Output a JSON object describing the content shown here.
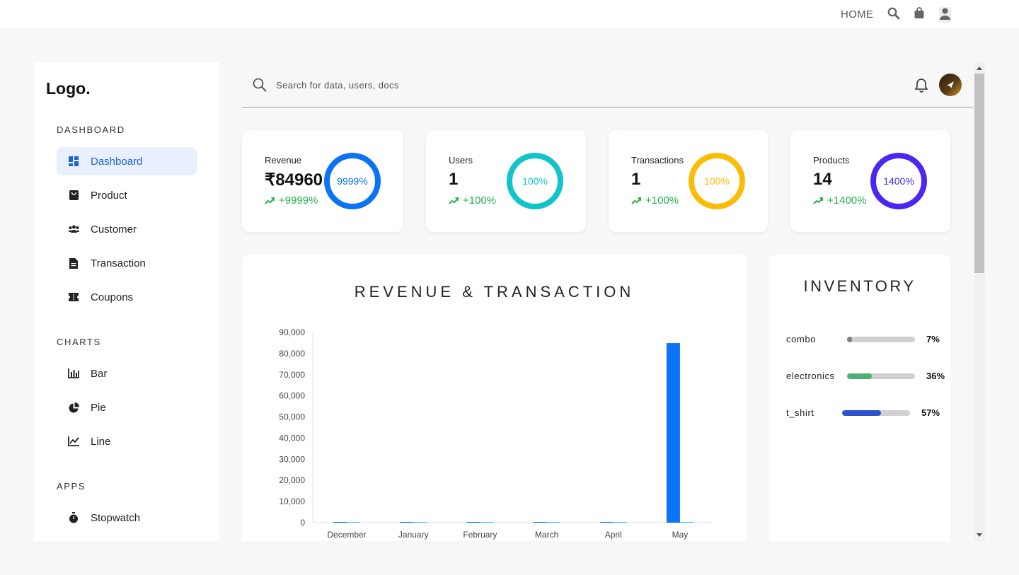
{
  "topnav": {
    "home_label": "HOME",
    "icons": [
      "search-icon",
      "bag-icon",
      "user-icon"
    ]
  },
  "sidebar": {
    "logo": "Logo.",
    "sections": [
      {
        "title": "DASHBOARD",
        "items": [
          {
            "label": "Dashboard",
            "icon": "dashboard-icon",
            "active": true
          },
          {
            "label": "Product",
            "icon": "product-icon"
          },
          {
            "label": "Customer",
            "icon": "customer-icon"
          },
          {
            "label": "Transaction",
            "icon": "transaction-icon"
          },
          {
            "label": "Coupons",
            "icon": "coupon-icon"
          }
        ]
      },
      {
        "title": "CHARTS",
        "items": [
          {
            "label": "Bar",
            "icon": "bar-chart-icon"
          },
          {
            "label": "Pie",
            "icon": "pie-chart-icon"
          },
          {
            "label": "Line",
            "icon": "line-chart-icon"
          }
        ]
      },
      {
        "title": "APPS",
        "items": [
          {
            "label": "Stopwatch",
            "icon": "stopwatch-icon"
          }
        ]
      }
    ]
  },
  "search": {
    "placeholder": "Search for data, users, docs"
  },
  "header_icons": [
    "bell-icon",
    "avatar"
  ],
  "stats": [
    {
      "label": "Revenue",
      "value": "₹84960",
      "change": "+9999%",
      "percent": "9999%",
      "color": "#0b73f5",
      "change_color": "#22b14c"
    },
    {
      "label": "Users",
      "value": "1",
      "change": "+100%",
      "percent": "100%",
      "color": "#10c5c9",
      "change_color": "#22b14c"
    },
    {
      "label": "Transactions",
      "value": "1",
      "change": "+100%",
      "percent": "100%",
      "color": "#fbbc05",
      "change_color": "#22b14c"
    },
    {
      "label": "Products",
      "value": "14",
      "change": "+1400%",
      "percent": "1400%",
      "color": "#4c26f2",
      "change_color": "#22b14c"
    }
  ],
  "revenue_chart": {
    "title": "REVENUE & TRANSACTION"
  },
  "chart_data": {
    "type": "bar",
    "title": "REVENUE & TRANSACTION",
    "categories": [
      "December",
      "January",
      "February",
      "March",
      "April",
      "May"
    ],
    "series": [
      {
        "values": [
          0,
          0,
          0,
          0,
          0,
          84960
        ],
        "color": "#0b73f5"
      },
      {
        "values": [
          0,
          0,
          0,
          0,
          0,
          1
        ],
        "color": "#4db8ff"
      }
    ],
    "ylim": [
      0,
      90000
    ],
    "yticks": [
      "90,000",
      "80,000",
      "70,000",
      "60,000",
      "50,000",
      "40,000",
      "30,000",
      "20,000",
      "10,000",
      "0"
    ],
    "grid": false,
    "legend": "none"
  },
  "inventory": {
    "title": "INVENTORY",
    "items": [
      {
        "name": "combo",
        "percent": 7,
        "percent_label": "7%",
        "color": "#808080"
      },
      {
        "name": "electronics",
        "percent": 36,
        "percent_label": "36%",
        "color": "#4caf7a"
      },
      {
        "name": "t_shirt",
        "percent": 57,
        "percent_label": "57%",
        "color": "#2e51cc"
      }
    ]
  }
}
